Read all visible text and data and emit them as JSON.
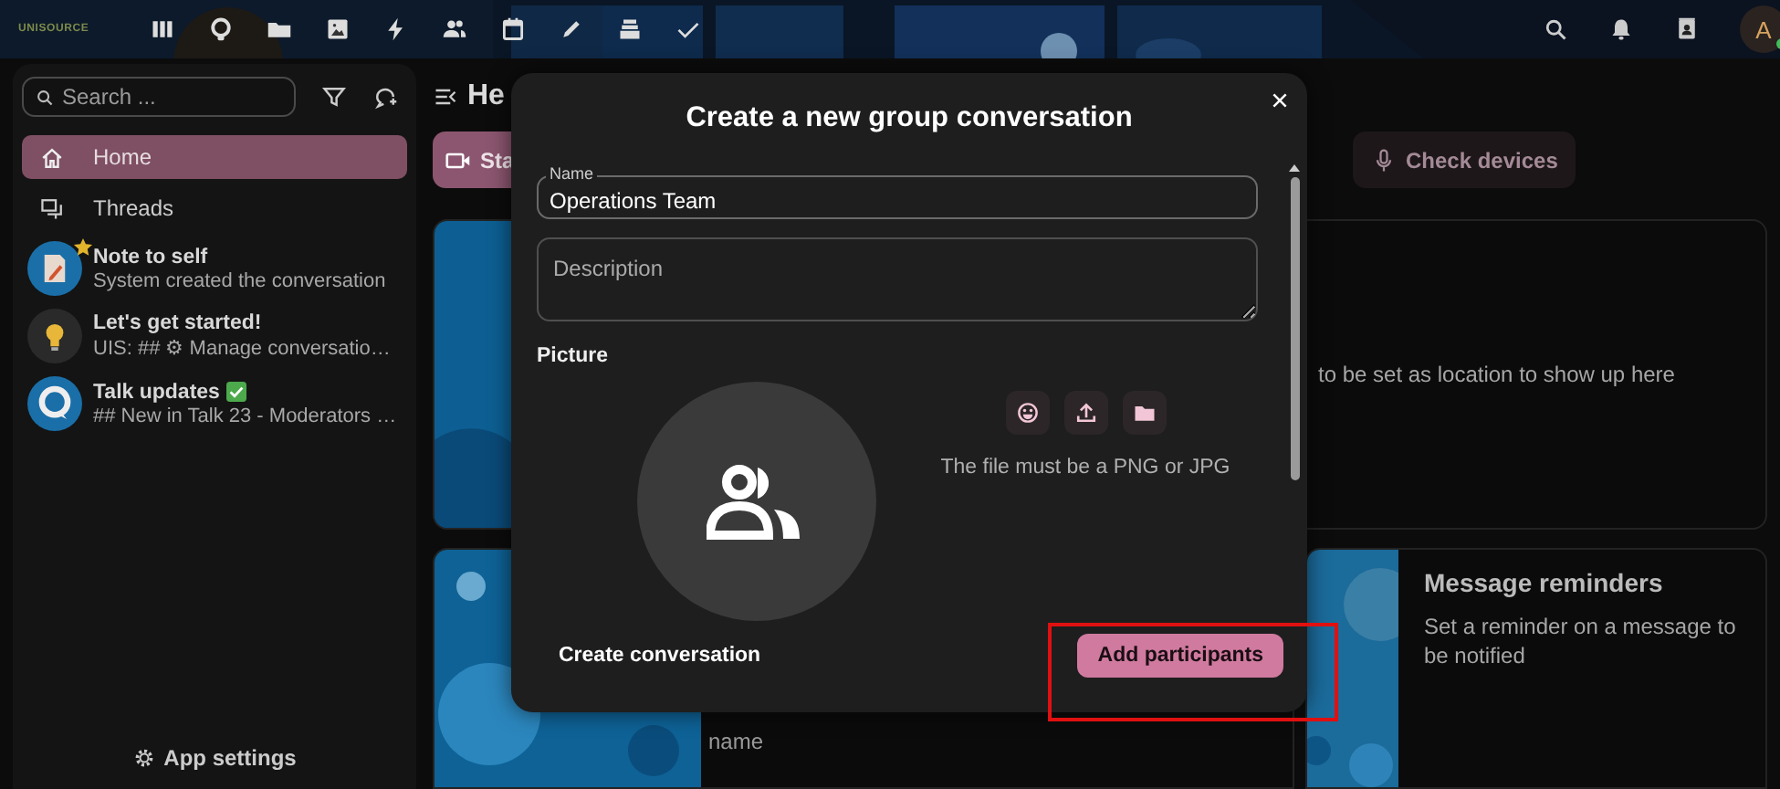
{
  "top_bar": {
    "logo": "UNISOURCE",
    "avatar": {
      "initial": "A",
      "online": true
    }
  },
  "sidebar": {
    "search": {
      "placeholder": "Search ..."
    },
    "nav": [
      {
        "label": "Home",
        "selected": true
      },
      {
        "label": "Threads",
        "selected": false
      }
    ],
    "conversations": [
      {
        "kind": "note",
        "name": "Note to self",
        "favorite": true,
        "preview": "System created the conversation"
      },
      {
        "kind": "bulb",
        "name": "Let's get started!",
        "preview": "UIS: ## ⚙ Manage conversatio…"
      },
      {
        "kind": "talk",
        "name": "Talk updates",
        "verified": true,
        "preview": "## New in Talk 23 - Moderators …"
      }
    ],
    "app_settings": "App settings"
  },
  "main": {
    "title": "He",
    "buttons": [
      {
        "label": "Sta",
        "kind": "primary"
      },
      {
        "label": "Check devices",
        "kind": "secondary"
      }
    ],
    "location_card": {
      "text": "to be set as location to show up here"
    },
    "name_card": {
      "text": "name"
    },
    "reminder_card": {
      "title": "Message reminders",
      "description": "Set a reminder on a message to be notified"
    }
  },
  "dialog": {
    "title": "Create a new group conversation",
    "name_field": {
      "label": "Name",
      "value": "Operations Team"
    },
    "description_field": {
      "placeholder": "Description"
    },
    "picture_label": "Picture",
    "file_hint": "The file must be a PNG or JPG",
    "secondary_action": "Create conversation",
    "primary_action": "Add participants",
    "highlighted": true
  }
}
